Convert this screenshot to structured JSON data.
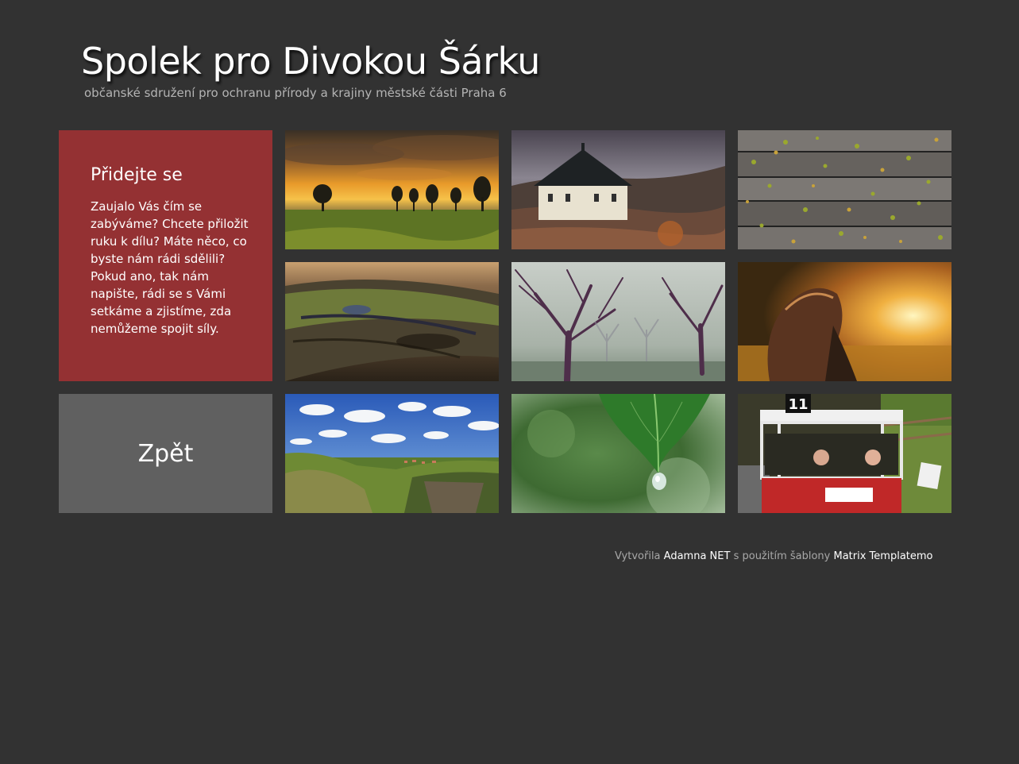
{
  "header": {
    "title": "Spolek pro Divokou Šárku",
    "subtitle": "občanské sdružení pro ochranu přírody a krajiny městské části Praha 6"
  },
  "join": {
    "title": "Přidejte se",
    "text": "Zaujalo Vás čím se zabýváme? Chcete přiložit ruku k dílu? Máte něco, co byste nám rádi sdělili? Pokud ano, tak nám napište, rádi se s Vámi setkáme a zjistíme, zda nemůžeme spojit síly.",
    "color": "#943133"
  },
  "back": {
    "label": "Zpět",
    "color": "#606060"
  },
  "gallery": {
    "photos": [
      "sunset-field-photo",
      "chapel-photo",
      "wooden-planks-leaves-photo",
      "mossy-log-photo",
      "foggy-trees-photo",
      "girl-sunset-photo",
      "valley-landscape-photo",
      "leaf-water-drop-photo",
      "tram-11-photo"
    ],
    "tram_number": "11"
  },
  "footer": {
    "prefix": "Vytvořila",
    "author_link": "Adamna NET",
    "middle": "s použitím šablony",
    "template_link": "Matrix Templatemo"
  }
}
